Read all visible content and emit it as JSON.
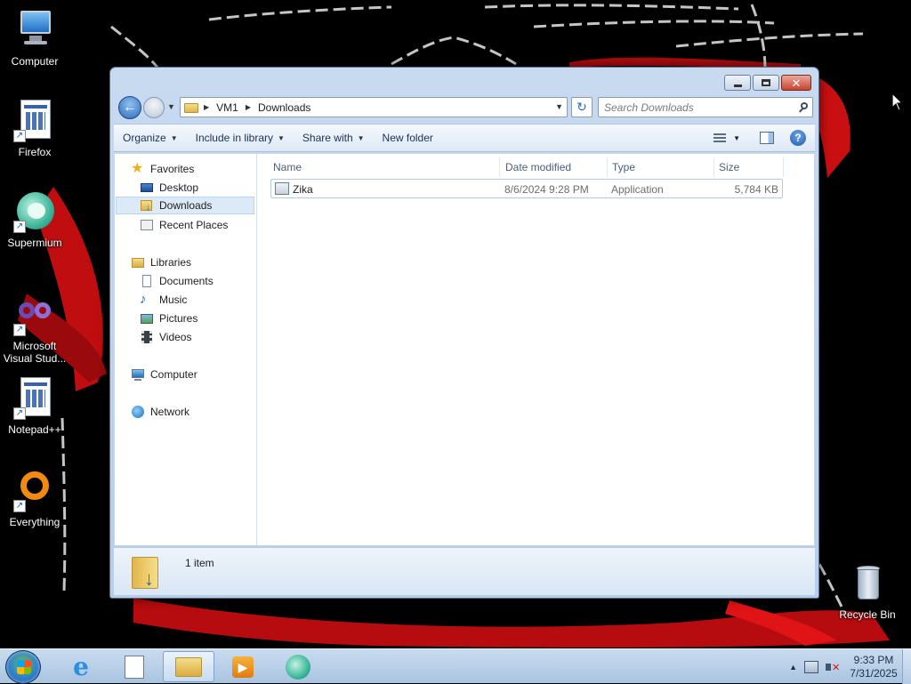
{
  "desktop": {
    "icons": [
      {
        "label": "Computer",
        "icon": "computer-icon"
      },
      {
        "label": "Firefox",
        "icon": "firefox-icon"
      },
      {
        "label": "Supermium",
        "icon": "supermium-icon"
      },
      {
        "label": "Microsoft Visual Stud...",
        "icon": "visual-studio-icon"
      },
      {
        "label": "Notepad++",
        "icon": "notepad-plus-plus-icon"
      },
      {
        "label": "Everything",
        "icon": "everything-icon"
      },
      {
        "label": "Recycle Bin",
        "icon": "recycle-bin-icon"
      }
    ]
  },
  "window": {
    "breadcrumb": [
      "VM1",
      "Downloads"
    ],
    "search_placeholder": "Search Downloads",
    "toolbar": {
      "organize": "Organize",
      "include_in_library": "Include in library",
      "share_with": "Share with",
      "new_folder": "New folder"
    },
    "nav": {
      "favorites": "Favorites",
      "desktop": "Desktop",
      "downloads": "Downloads",
      "recent_places": "Recent Places",
      "libraries": "Libraries",
      "documents": "Documents",
      "music": "Music",
      "pictures": "Pictures",
      "videos": "Videos",
      "computer": "Computer",
      "network": "Network"
    },
    "columns": {
      "name": "Name",
      "date_modified": "Date modified",
      "type": "Type",
      "size": "Size"
    },
    "files": [
      {
        "name": "Zika",
        "date_modified": "8/6/2024 9:28 PM",
        "type": "Application",
        "size": "5,784 KB"
      }
    ],
    "details": {
      "item_count": "1 item"
    }
  },
  "taskbar": {
    "pinned": [
      "internet-explorer-icon",
      "notepad-plus-plus-icon",
      "windows-explorer-icon",
      "media-player-icon",
      "supermium-icon"
    ],
    "clock": {
      "time": "9:33 PM",
      "date": "7/31/2025"
    }
  },
  "colors": {
    "wallpaper_black": "#000000",
    "wallpaper_red": "#d10f12",
    "window_chrome": "#b7cde9",
    "selection": "#dceaf8",
    "close_button": "#c7432f"
  }
}
